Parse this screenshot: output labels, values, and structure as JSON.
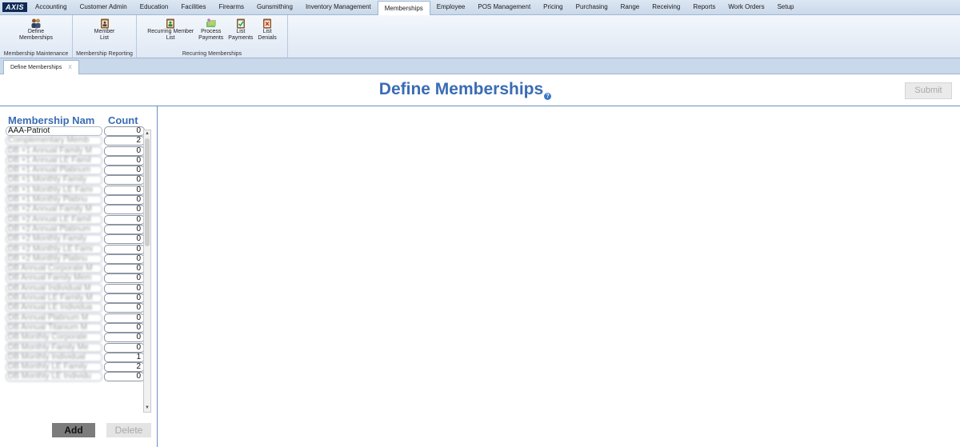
{
  "logo": "AXIS",
  "menu": [
    {
      "label": "Accounting"
    },
    {
      "label": "Customer Admin"
    },
    {
      "label": "Education"
    },
    {
      "label": "Facilities"
    },
    {
      "label": "Firearms"
    },
    {
      "label": "Gunsmithing"
    },
    {
      "label": "Inventory Management"
    },
    {
      "label": "Memberships"
    },
    {
      "label": "Employee"
    },
    {
      "label": "POS Management"
    },
    {
      "label": "Pricing"
    },
    {
      "label": "Purchasing"
    },
    {
      "label": "Range"
    },
    {
      "label": "Receiving"
    },
    {
      "label": "Reports"
    },
    {
      "label": "Work Orders"
    },
    {
      "label": "Setup"
    }
  ],
  "active_menu": "Memberships",
  "ribbon": {
    "groups": [
      {
        "label": "Membership Maintenance",
        "buttons": [
          {
            "label": "Define\nMemberships",
            "icon": "people-icon"
          }
        ]
      },
      {
        "label": "Membership Reporting",
        "buttons": [
          {
            "label": "Member\nList",
            "icon": "clipboard-icon"
          }
        ]
      },
      {
        "label": "Recurring Memberships",
        "buttons": [
          {
            "label": "Recurring Member\nList",
            "icon": "clipboard-green-icon"
          },
          {
            "label": "Process\nPayments",
            "icon": "payments-icon"
          },
          {
            "label": "List\nPayments",
            "icon": "checklist-icon"
          },
          {
            "label": "List\nDenials",
            "icon": "denial-icon"
          }
        ]
      }
    ]
  },
  "tab": {
    "label": "Define Memberships",
    "close": "X"
  },
  "page": {
    "title": "Define Memberships",
    "help": "?",
    "submit": "Submit"
  },
  "list": {
    "header_name": "Membership Nam",
    "header_count": "Count",
    "rows": [
      {
        "name": "AAA-Patriot",
        "count": "0"
      },
      {
        "name": "Complementary Memb",
        "count": "2"
      },
      {
        "name": "DB +1 Annual Family M",
        "count": "0"
      },
      {
        "name": "DB +1 Annual LE Famil",
        "count": "0"
      },
      {
        "name": "DB +1 Annual Platinum",
        "count": "0"
      },
      {
        "name": "DB +1 Monthly Family",
        "count": "0"
      },
      {
        "name": "DB +1 Monthly LE Fami",
        "count": "0"
      },
      {
        "name": "DB +1 Monthly Platinu",
        "count": "0"
      },
      {
        "name": "DB +2 Annual Family M",
        "count": "0"
      },
      {
        "name": "DB +2 Annual LE Famil",
        "count": "0"
      },
      {
        "name": "DB +2 Annual Platinum",
        "count": "0"
      },
      {
        "name": "DB +2 Monthly Family",
        "count": "0"
      },
      {
        "name": "DB +2 Monthly LE Fami",
        "count": "0"
      },
      {
        "name": "DB +2 Monthly Platinu",
        "count": "0"
      },
      {
        "name": "DB Annual Corporate M",
        "count": "0"
      },
      {
        "name": "DB Annual Family Mem",
        "count": "0"
      },
      {
        "name": "DB Annual Individual M",
        "count": "0"
      },
      {
        "name": "DB Annual LE Family M",
        "count": "0"
      },
      {
        "name": "DB Annual LE Individua",
        "count": "0"
      },
      {
        "name": "DB Annual Platinum M",
        "count": "0"
      },
      {
        "name": "DB Annual Titanium M",
        "count": "0"
      },
      {
        "name": "DB Monthly Corporate",
        "count": "0"
      },
      {
        "name": "DB Monthly Family Me",
        "count": "0"
      },
      {
        "name": "DB Monthly Individual",
        "count": "1"
      },
      {
        "name": "DB Monthly LE Family",
        "count": "2"
      },
      {
        "name": "DB Monthly LE Individu",
        "count": "0"
      }
    ]
  },
  "buttons": {
    "add": "Add",
    "delete": "Delete"
  }
}
